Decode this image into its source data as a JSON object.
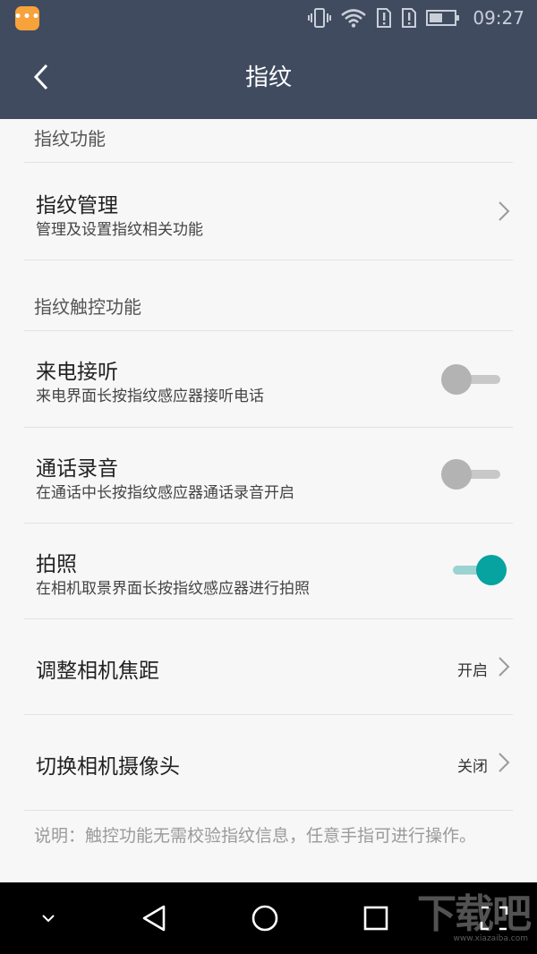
{
  "status_bar": {
    "time": "09:27",
    "icons": [
      "app-notification-icon",
      "vibrate-icon",
      "wifi-icon",
      "sim-alert-icon",
      "sim-alert-icon",
      "battery-icon"
    ]
  },
  "title_bar": {
    "back_icon": "chevron-left-icon",
    "title": "指纹"
  },
  "sections": {
    "fingerprint_function": {
      "header": "指纹功能"
    },
    "fingerprint_touch": {
      "header": "指纹触控功能"
    }
  },
  "rows": {
    "fingerprint_management": {
      "title": "指纹管理",
      "subtitle": "管理及设置指纹相关功能"
    },
    "answer_call": {
      "title": "来电接听",
      "subtitle": "来电界面长按指纹感应器接听电话",
      "enabled": false
    },
    "call_recording": {
      "title": "通话录音",
      "subtitle": "在通话中长按指纹感应器通话录音开启",
      "enabled": false
    },
    "take_photo": {
      "title": "拍照",
      "subtitle": "在相机取景界面长按指纹感应器进行拍照",
      "enabled": true
    },
    "adjust_focus": {
      "title": "调整相机焦距",
      "value": "开启"
    },
    "switch_camera": {
      "title": "切换相机摄像头",
      "value": "关闭"
    }
  },
  "note": "说明：触控功能无需校验指纹信息，任意手指可进行操作。",
  "nav_bar": {
    "buttons": [
      "notification-down-icon",
      "back-triangle-icon",
      "home-circle-icon",
      "recents-square-icon"
    ],
    "watermark": "下载吧",
    "watermark_url": "www.xiazaiba.com"
  },
  "colors": {
    "header": "#404b60",
    "accent": "#06a3a0",
    "background": "#f7f7f7"
  }
}
